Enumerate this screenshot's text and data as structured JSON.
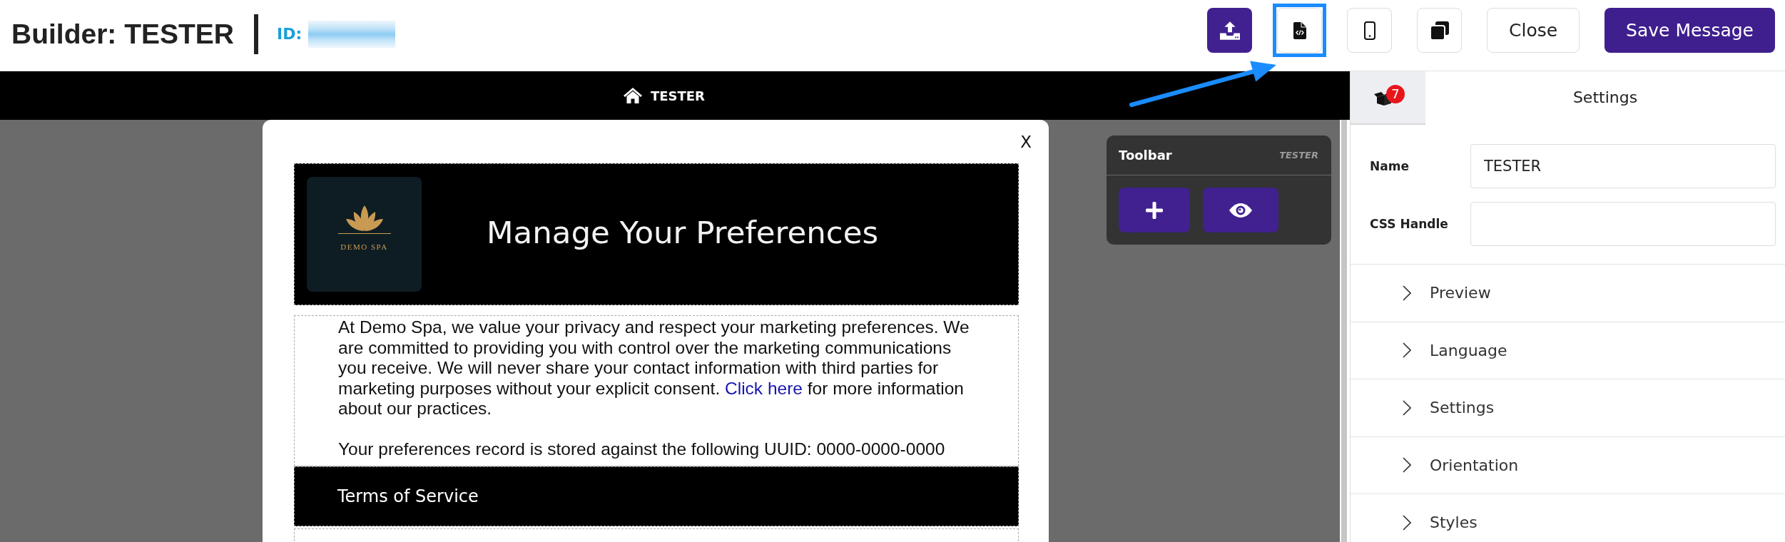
{
  "header": {
    "title": "Builder: TESTER",
    "id_label": "ID:"
  },
  "icon_buttons": [
    {
      "kind": "primary",
      "highlighted": false
    },
    {
      "kind": "outline",
      "highlighted": true
    },
    {
      "kind": "outline",
      "highlighted": false
    },
    {
      "kind": "outline",
      "highlighted": false
    }
  ],
  "buttons": [
    {
      "label": "Close",
      "kind": "outline"
    },
    {
      "label": "Save Message",
      "kind": "primary"
    }
  ],
  "preview_bar": {
    "title": "TESTER"
  },
  "modal": {
    "close_label": "X",
    "title": "Manage Your Preferences",
    "logo_text": "DEMO SPA",
    "intro": {
      "before": "At Demo Spa, we value your privacy and respect your marketing preferences. We are committed to providing you with control over the marketing communications you receive. We will never share your contact information with third parties for marketing purposes without your explicit consent.",
      "link": "Click here",
      "after": "for more information about our practices."
    },
    "uuid_line": "Your preferences record is stored against the following UUID: 0000-0000-0000",
    "section_title": "Terms of Service"
  },
  "toolbar": {
    "title": "Toolbar",
    "context": "TESTER"
  },
  "panel": {
    "tabs": [
      {
        "kind": "components",
        "badge": "7",
        "selected": false
      },
      {
        "kind": "text",
        "label": "Settings",
        "selected": true
      }
    ],
    "fields": [
      {
        "label": "Name",
        "value": "TESTER"
      },
      {
        "label": "CSS Handle"
      }
    ],
    "sections": [
      {
        "label": "Preview",
        "expanded": false
      },
      {
        "label": "Language",
        "expanded": false
      },
      {
        "label": "Settings",
        "expanded": false
      },
      {
        "label": "Orientation",
        "expanded": false
      },
      {
        "label": "Styles",
        "expanded": false
      }
    ]
  }
}
